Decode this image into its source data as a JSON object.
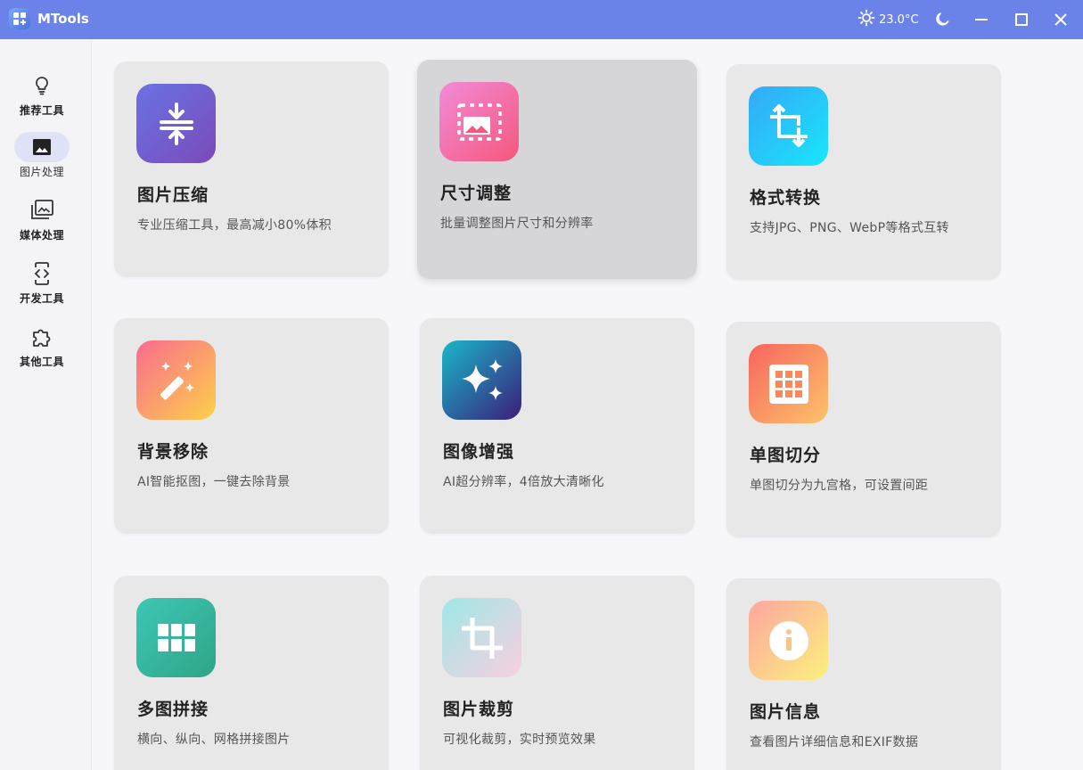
{
  "app": {
    "title": "MTools",
    "weather": "23.0°C"
  },
  "colors": {
    "titlebar": "#6b83e8",
    "active_nav": "#dfe2f5"
  },
  "sidebar": {
    "items": [
      {
        "label": "推荐工具",
        "icon": "lightbulb-icon"
      },
      {
        "label": "图片处理",
        "icon": "image-icon",
        "active": true
      },
      {
        "label": "媒体处理",
        "icon": "photo-library-icon"
      },
      {
        "label": "开发工具",
        "icon": "code-device-icon"
      },
      {
        "label": "其他工具",
        "icon": "puzzle-icon"
      }
    ]
  },
  "cards": [
    {
      "title": "图片压缩",
      "desc": "专业压缩工具，最高减小80%体积",
      "icon": "compress-icon"
    },
    {
      "title": "尺寸调整",
      "desc": "批量调整图片尺寸和分辨率",
      "icon": "resize-icon"
    },
    {
      "title": "格式转换",
      "desc": "支持JPG、PNG、WebP等格式互转",
      "icon": "crop-rotate-icon"
    },
    {
      "title": "背景移除",
      "desc": "AI智能抠图，一键去除背景",
      "icon": "magic-wand-icon"
    },
    {
      "title": "图像增强",
      "desc": "AI超分辨率，4倍放大清晰化",
      "icon": "sparkles-icon"
    },
    {
      "title": "单图切分",
      "desc": "单图切分为九宫格，可设置间距",
      "icon": "grid-icon"
    },
    {
      "title": "多图拼接",
      "desc": "横向、纵向、网格拼接图片",
      "icon": "tiles-icon"
    },
    {
      "title": "图片裁剪",
      "desc": "可视化裁剪，实时预览效果",
      "icon": "crop-icon"
    },
    {
      "title": "图片信息",
      "desc": "查看图片详细信息和EXIF数据",
      "icon": "info-icon"
    }
  ]
}
